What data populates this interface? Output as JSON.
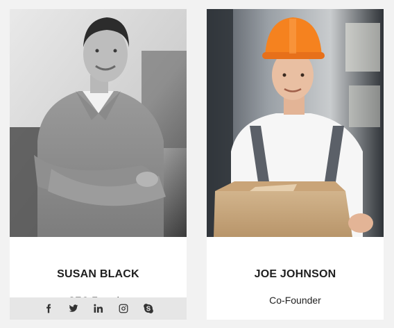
{
  "members": [
    {
      "name": "SUSAN BLACK",
      "role": "SEO Founder",
      "photo_style": "grayscale",
      "social": [
        "facebook-icon",
        "twitter-icon",
        "linkedin-icon",
        "instagram-icon",
        "skype-icon"
      ]
    },
    {
      "name": "JOE JOHNSON",
      "role": "Co-Founder",
      "photo_style": "color"
    }
  ],
  "colors": {
    "page_bg": "#f2f2f2",
    "card_bg": "#ffffff",
    "social_bar_bg": "#e6e6e6",
    "hardhat": "#f5821f",
    "text": "#1e1e1e"
  }
}
